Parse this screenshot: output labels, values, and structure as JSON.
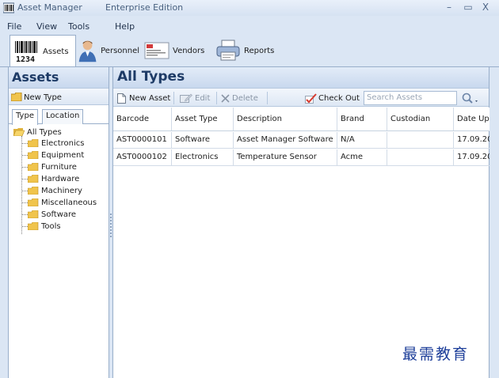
{
  "window": {
    "app_title": "Asset Manager",
    "edition": "Enterprise Edition",
    "minimize_glyph": "–",
    "maximize_glyph": "▭",
    "close_glyph": "X"
  },
  "menu": [
    "File",
    "View",
    "Tools",
    "Help"
  ],
  "modules": [
    {
      "label": "Assets",
      "icon": "barcode-icon",
      "barcode_digits": "1234"
    },
    {
      "label": "Personnel",
      "icon": "person-icon"
    },
    {
      "label": "Vendors",
      "icon": "vendor-card-icon"
    },
    {
      "label": "Reports",
      "icon": "printer-icon"
    }
  ],
  "left_pane": {
    "title": "Assets",
    "new_button": "New Type",
    "tabs": [
      "Type",
      "Location"
    ],
    "tree_root": "All Types",
    "tree_items": [
      "Electronics",
      "Equipment",
      "Furniture",
      "Hardware",
      "Machinery",
      "Miscellaneous",
      "Software",
      "Tools"
    ]
  },
  "right_pane": {
    "title": "All Types",
    "toolbar": {
      "new_asset": "New Asset",
      "edit": "Edit",
      "delete": "Delete",
      "check_out": "Check Out",
      "search_placeholder": "Search Assets"
    },
    "columns": [
      "Barcode",
      "Asset Type",
      "Description",
      "Brand",
      "Custodian",
      "Date Up"
    ],
    "rows": [
      {
        "barcode": "AST0000101",
        "type": "Software",
        "description": "Asset Manager Software",
        "brand": "N/A",
        "custodian": "",
        "date": "17.09.20"
      },
      {
        "barcode": "AST0000102",
        "type": "Electronics",
        "description": "Temperature Sensor",
        "brand": "Acme",
        "custodian": "",
        "date": "17.09.20"
      }
    ]
  },
  "watermark": "最需教育",
  "colors": {
    "accent": "#1e3b66",
    "frame": "#dbe6f4",
    "border": "#98aeca",
    "folder": "#f0c44c",
    "check": "#d63a2f"
  }
}
